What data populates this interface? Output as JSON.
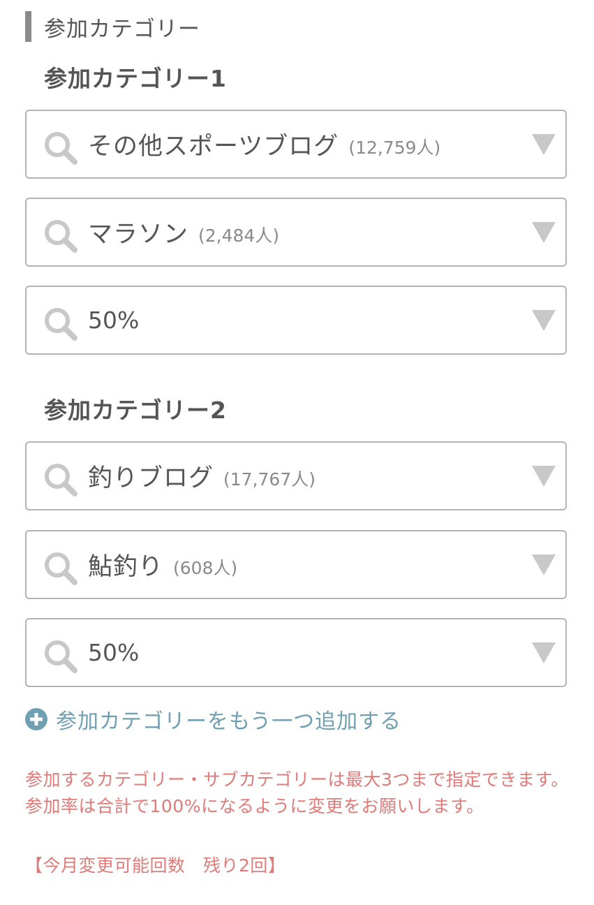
{
  "section": {
    "title": "参加カテゴリー"
  },
  "groups": [
    {
      "title": "参加カテゴリー1",
      "category": {
        "name": "その他スポーツブログ",
        "count": "(12,759人)"
      },
      "subcategory": {
        "name": "マラソン",
        "count": "(2,484人)"
      },
      "rate": "50%"
    },
    {
      "title": "参加カテゴリー2",
      "category": {
        "name": "釣りブログ",
        "count": "(17,767人)"
      },
      "subcategory": {
        "name": "鮎釣り",
        "count": "(608人)"
      },
      "rate": "50%"
    }
  ],
  "add_link": {
    "label": "参加カテゴリーをもう一つ追加する"
  },
  "notice": {
    "text": "参加するカテゴリー・サブカテゴリーは最大3つまで指定できます。参加率は合計で100%になるように変更をお願いします。",
    "remaining": "【今月変更可能回数　残り2回】"
  },
  "icons": {
    "search": "search-icon",
    "dropdown": "triangle-down-icon",
    "add": "plus-circle-icon"
  },
  "colors": {
    "text": "#555555",
    "count": "#8a8a8a",
    "border": "#b3b3b3",
    "icon": "#c8c8c8",
    "link": "#6f9fb0",
    "notice": "#e27a7a"
  }
}
